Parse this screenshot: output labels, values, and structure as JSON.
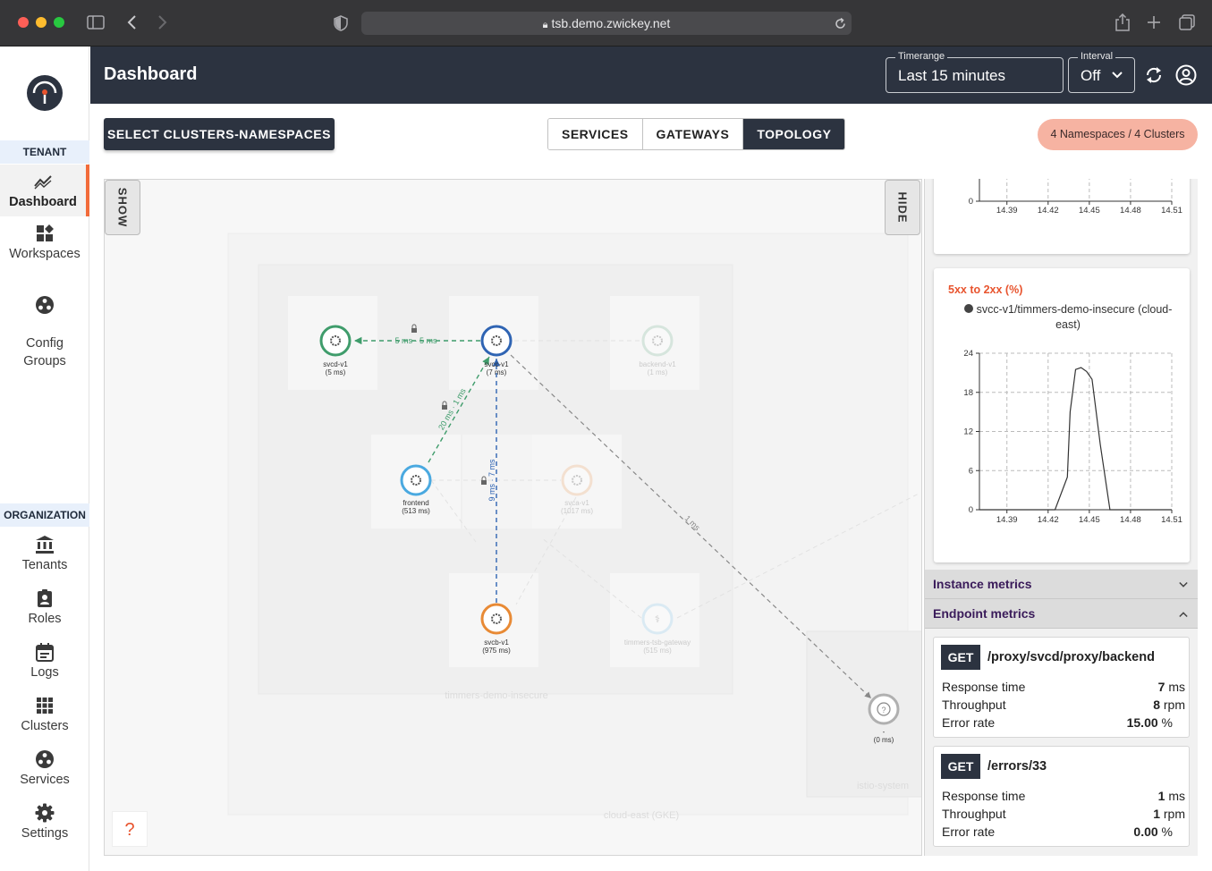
{
  "browser": {
    "url": "tsb.demo.zwickey.net"
  },
  "sidebar": {
    "tenant_header": "TENANT",
    "tenant_items": [
      {
        "label": "Dashboard",
        "icon": "chart-line-icon",
        "active": true
      },
      {
        "label": "Workspaces",
        "icon": "workspaces-icon"
      },
      {
        "label": "Config\nGroups",
        "icon": "config-groups-icon"
      }
    ],
    "org_header": "ORGANIZATION",
    "org_items": [
      {
        "label": "Tenants",
        "icon": "bank-icon"
      },
      {
        "label": "Roles",
        "icon": "badge-icon"
      },
      {
        "label": "Logs",
        "icon": "calendar-icon"
      },
      {
        "label": "Clusters",
        "icon": "grid-icon"
      },
      {
        "label": "Services",
        "icon": "services-icon"
      },
      {
        "label": "Settings",
        "icon": "gear-icon"
      }
    ]
  },
  "header": {
    "title": "Dashboard",
    "timerange": {
      "label": "Timerange",
      "value": "Last 15 minutes"
    },
    "interval": {
      "label": "Interval",
      "value": "Off"
    }
  },
  "toolbar": {
    "select_button": "SELECT CLUSTERS-NAMESPACES",
    "tabs": [
      "SERVICES",
      "GATEWAYS",
      "TOPOLOGY"
    ],
    "active_tab": "TOPOLOGY",
    "namespaces_chip": "4 Namespaces / 4 Clusters"
  },
  "topology": {
    "show_label": "SHOW",
    "hide_label": "HIDE",
    "help": "?",
    "group_labels": {
      "namespace": "timmers-demo-insecure",
      "cluster": "cloud-east (GKE)",
      "system": "istio-system"
    },
    "nodes": [
      {
        "name": "svcd-v1",
        "latency": "(5 ms)",
        "color": "#3f9c6b"
      },
      {
        "name": "svcc-v1",
        "latency": "(7 ms)",
        "color": "#2f64b3"
      },
      {
        "name": "backend-v1",
        "latency": "(1 ms)",
        "color": "#9cc7b0",
        "faded": true
      },
      {
        "name": "frontend",
        "latency": "(513 ms)",
        "color": "#4aa9e0"
      },
      {
        "name": "svca-v1",
        "latency": "(1017 ms)",
        "color": "#f0b98c",
        "faded": true
      },
      {
        "name": "svcb-v1",
        "latency": "(975 ms)",
        "color": "#e88a35"
      },
      {
        "name": "timmers-tsb-gateway",
        "latency": "(515 ms)",
        "color": "#a9d6f0",
        "faded": true
      },
      {
        "name": "-",
        "latency": "(0 ms)",
        "color": "#b0b0b0"
      }
    ],
    "edges": [
      {
        "label": "5 ms · 5 ms",
        "color": "#3f9c6b"
      },
      {
        "label": "20 ms · 1 ms",
        "color": "#3f9c6b"
      },
      {
        "label": "9 ms · 7 ms",
        "color": "#2f64b3"
      },
      {
        "label": "1 ms",
        "color": "#999999"
      }
    ]
  },
  "panel": {
    "top_chart": {
      "type": "line",
      "x": [
        "14.39",
        "14.42",
        "14.45",
        "14.48",
        "14.51"
      ],
      "y_ticks": [
        "0"
      ]
    },
    "error_chart": {
      "title": "5xx to 2xx (%)",
      "legend": "svcc-v1/timmers-demo-insecure (cloud-east)",
      "chart_data": {
        "type": "line",
        "title": "5xx to 2xx (%)",
        "x_ticks": [
          "14.39",
          "14.42",
          "14.45",
          "14.48",
          "14.51"
        ],
        "y_ticks": [
          "0",
          "6",
          "12",
          "18",
          "24"
        ],
        "ylim": [
          0,
          24
        ],
        "series": [
          {
            "name": "svcc-v1/timmers-demo-insecure (cloud-east)",
            "x": [
              14.37,
              14.425,
              14.434,
              14.436,
              14.44,
              14.444,
              14.448,
              14.452,
              14.458,
              14.465,
              14.51
            ],
            "y": [
              0,
              0,
              5,
              15,
              21.5,
              21.8,
              21.2,
              20,
              10,
              0,
              0
            ]
          }
        ],
        "grid": true
      }
    },
    "instance_metrics": "Instance metrics",
    "endpoint_metrics": "Endpoint metrics",
    "endpoints": [
      {
        "method": "GET",
        "path": "/proxy/svcd/proxy/backend",
        "rows": [
          {
            "label": "Response time",
            "value": "7",
            "unit": "ms"
          },
          {
            "label": "Throughput",
            "value": "8",
            "unit": "rpm"
          },
          {
            "label": "Error rate",
            "value": "15.00",
            "unit": "%"
          }
        ]
      },
      {
        "method": "GET",
        "path": "/errors/33",
        "rows": [
          {
            "label": "Response time",
            "value": "1",
            "unit": "ms"
          },
          {
            "label": "Throughput",
            "value": "1",
            "unit": "rpm"
          },
          {
            "label": "Error rate",
            "value": "0.00",
            "unit": "%"
          }
        ]
      }
    ]
  },
  "colors": {
    "accent": "#f26b3a",
    "header": "#2c3340",
    "chip": "#f6b3a2",
    "chart_title": "#e8542e",
    "section_title": "#3a1b5a"
  }
}
